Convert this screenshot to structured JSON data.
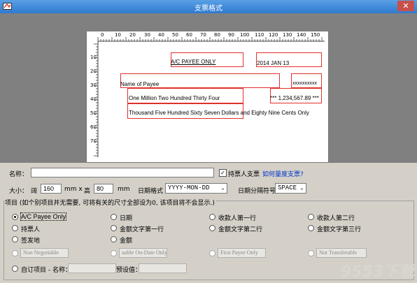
{
  "window": {
    "title": "支票格式",
    "close": "✕"
  },
  "preview": {
    "top_ruler": [
      "0",
      "10",
      "20",
      "30",
      "40",
      "50",
      "60",
      "70",
      "80",
      "90",
      "100",
      "110",
      "120",
      "130",
      "140",
      "150"
    ],
    "left_ruler": [
      "10",
      "20",
      "30",
      "40",
      "50",
      "60",
      "70"
    ],
    "payee_only": "A/C PAYEE ONLY",
    "date": "2014 JAN 13",
    "name_of_payee": "Name of Payee",
    "xmarks": "xxxxxxxxxx",
    "amount_words_1": "One Million Two Hundred Thirty Four",
    "amount_number": "*** 1,234,567.89 ***",
    "amount_words_2": "Thousand Five Hundred Sixty Seven Dollars and Eighty Nine Cents Only"
  },
  "form": {
    "name_label": "名称：",
    "name_value": "",
    "holder_check_label": "持票人支票",
    "how_measure_link": "如何量度支票?",
    "size_label": "大小：",
    "width_label": "阔",
    "width_value": "160",
    "mm1": "mm x",
    "height_label": "高",
    "height_value": "80",
    "mm2": "mm",
    "date_format_label": "日期格式",
    "date_format_value": "YYYY-MON-DD",
    "date_sep_label": "日期分隔符号",
    "date_sep_value": "SPACE",
    "group_title": "项目 (如个别项目并无需要, 可将有关的尺寸全部设为0, 该项目将不会显示.)"
  },
  "options": {
    "ac_payee_only": "A/C Payee Only",
    "date": "日期",
    "payee_line1": "收款人第一行",
    "payee_line2": "收款人第二行",
    "holder": "持票人",
    "amount_words_line1": "金额文字第一行",
    "amount_words_line2": "金额文字第二行",
    "amount_words_line3": "金额文字第三行",
    "issue_place": "签发地",
    "amount": "金额",
    "non_negotiable": "Non Negotiable",
    "valuable_on_date": "uable On-Date Only",
    "first_payee_only": "First Payee Only",
    "not_transferable": "Not Transferable",
    "custom_item": "自订项目 - 名称：",
    "preset_value": "预设值："
  },
  "watermark": "9553下载"
}
